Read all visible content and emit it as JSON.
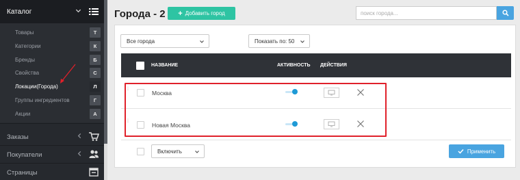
{
  "sidebar": {
    "section_title": "Каталог",
    "sub_items": [
      {
        "label": "Товары",
        "letter": "Т",
        "active": false
      },
      {
        "label": "Категории",
        "letter": "К",
        "active": false
      },
      {
        "label": "Бренды",
        "letter": "Б",
        "active": false
      },
      {
        "label": "Свойства",
        "letter": "С",
        "active": false
      },
      {
        "label": "Локации(Города)",
        "letter": "Л",
        "active": true
      },
      {
        "label": "Группы ингредиентов",
        "letter": "Г",
        "active": false
      },
      {
        "label": "Акции",
        "letter": "А",
        "active": false
      }
    ],
    "main_items": [
      {
        "label": "Заказы",
        "icon": "cart-icon"
      },
      {
        "label": "Покупатели",
        "icon": "users-icon"
      },
      {
        "label": "Страницы",
        "icon": "calendar-icon"
      }
    ]
  },
  "header": {
    "title": "Города - 2",
    "add_button": "Добавить город",
    "search_placeholder": "поиск города..."
  },
  "filters": {
    "city_filter": "Все города",
    "per_page": "Показать по: 50"
  },
  "table": {
    "columns": {
      "name": "НАЗВАНИЕ",
      "active": "АКТИВНОСТЬ",
      "actions": "ДЕЙСТВИЯ"
    },
    "rows": [
      {
        "name": "Москва",
        "active": true
      },
      {
        "name": "Новая Москва",
        "active": true
      }
    ]
  },
  "footer": {
    "bulk_action": "Включить",
    "apply_button": "Применить"
  },
  "colors": {
    "accent_green": "#2ec4a3",
    "accent_blue": "#49a4e0",
    "highlight_red": "#e0202a",
    "sidebar_dark": "#26292e"
  }
}
